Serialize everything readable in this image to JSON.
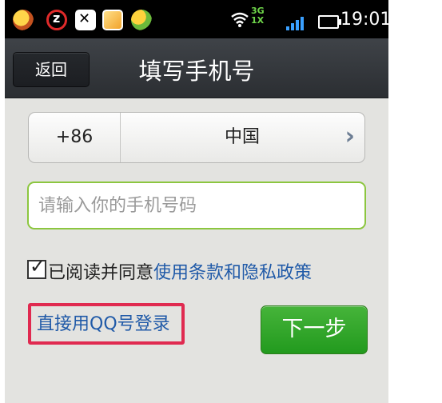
{
  "status_bar": {
    "network_top": "3G",
    "network_bottom": "1X",
    "time": "19:01",
    "icons": [
      "app-icon",
      "clock-app-icon",
      "close-app-icon",
      "photo-app-icon",
      "ball-app-icon",
      "wifi-icon",
      "signal-icon",
      "battery-icon"
    ]
  },
  "titlebar": {
    "back_label": "返回",
    "title": "填写手机号"
  },
  "country": {
    "code": "+86",
    "name": "中国"
  },
  "phone_input": {
    "value": "",
    "placeholder": "请输入你的手机号码"
  },
  "agreement": {
    "checked": true,
    "text": "已阅读并同意",
    "link": "使用条款和隐私政策"
  },
  "qq_login": "直接用QQ号登录",
  "next_button": "下一步",
  "colors": {
    "accent_green": "#229a1e",
    "link_blue": "#205aa8",
    "highlight_red": "#e02a50",
    "input_border": "#8cc63f"
  }
}
